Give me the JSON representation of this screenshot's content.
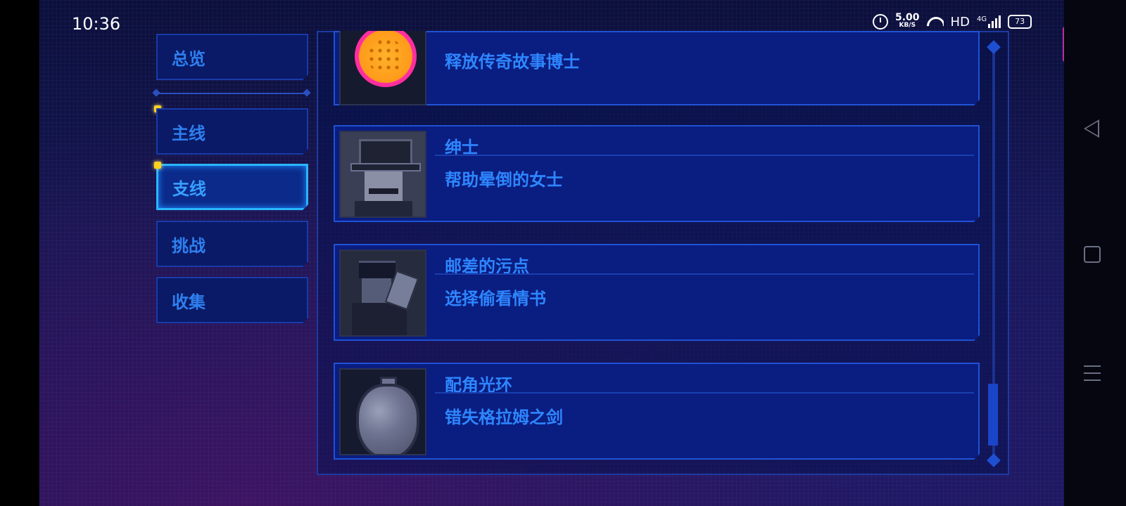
{
  "status_bar": {
    "time": "10:36",
    "net_speed": "5.00",
    "net_unit": "KB/S",
    "hd": "HD",
    "network": "4G",
    "battery": "73"
  },
  "sidebar": {
    "tabs": [
      {
        "label": "总览"
      },
      {
        "label": "主线"
      },
      {
        "label": "支线"
      },
      {
        "label": "挑战"
      },
      {
        "label": "收集"
      }
    ],
    "active_tab": "支线"
  },
  "achievements": [
    {
      "title": "",
      "description": "释放传奇故事博士",
      "icon": "golden-orb-icon"
    },
    {
      "title": "绅士",
      "description": "帮助晕倒的女士",
      "icon": "gentleman-icon"
    },
    {
      "title": "邮差的污点",
      "description": "选择偷看情书",
      "icon": "postman-icon"
    },
    {
      "title": "配角光环",
      "description": "错失格拉姆之剑",
      "icon": "halo-egg-icon"
    }
  ],
  "colors": {
    "accent": "#2e86ff",
    "active_border": "#29b6ff",
    "close": "#e23bb4",
    "highlight_dot": "#ffd21f"
  }
}
